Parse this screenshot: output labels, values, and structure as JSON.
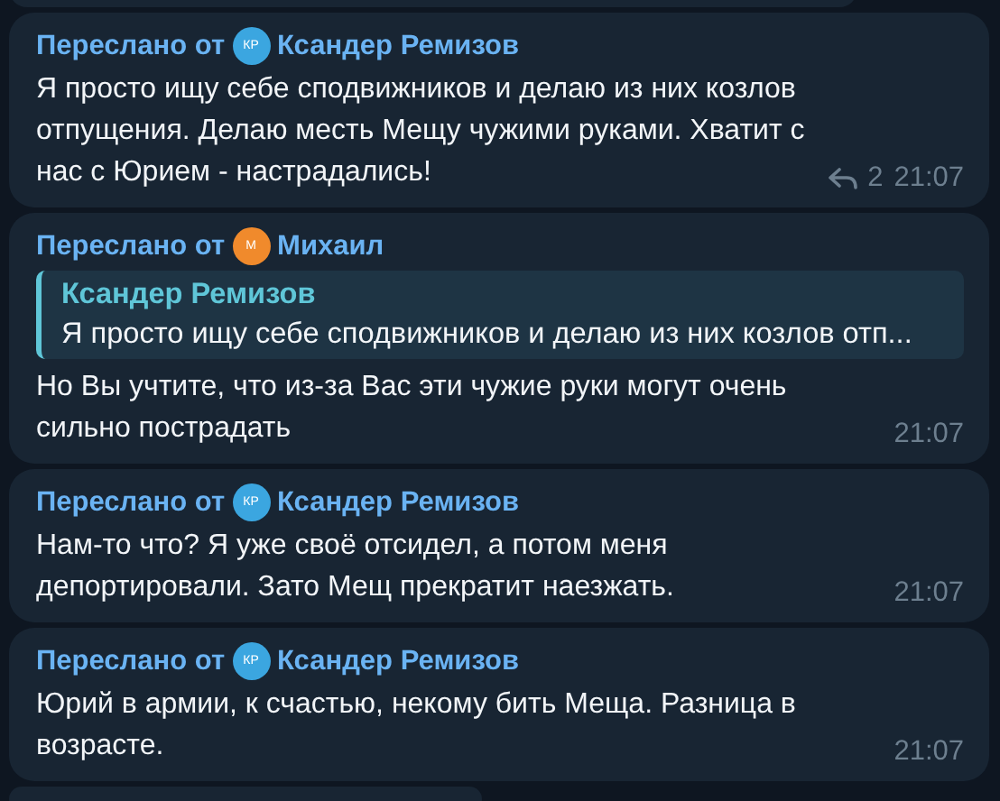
{
  "messages": [
    {
      "forwarded_label": "Переслано от",
      "from": {
        "initials": "КР",
        "name": "Ксандер Ремизов",
        "color": "#3ba6e0"
      },
      "text": "Я просто ищу себе сподвижников и делаю из них козлов отпущения. Делаю месть Мещу чужими руками. Хватит с нас с Юрием - настрадались!",
      "replies": "2",
      "time": "21:07"
    },
    {
      "forwarded_label": "Переслано от",
      "from": {
        "initials": "М",
        "name": "Михаил",
        "color": "#f08a2c"
      },
      "quote": {
        "name": "Ксандер Ремизов",
        "text": "Я просто ищу себе сподвижников и делаю из них козлов отп..."
      },
      "text": "Но Вы учтите, что из-за Вас эти чужие руки могут очень сильно пострадать",
      "time": "21:07"
    },
    {
      "forwarded_label": "Переслано от",
      "from": {
        "initials": "КР",
        "name": "Ксандер Ремизов",
        "color": "#3ba6e0"
      },
      "text": "Нам-то что? Я уже своё отсидел, а потом меня депортировали. Зато Мещ прекратит наезжать.",
      "time": "21:07"
    },
    {
      "forwarded_label": "Переслано от",
      "from": {
        "initials": "КР",
        "name": "Ксандер Ремизов",
        "color": "#3ba6e0"
      },
      "text": "Юрий в армии, к счастью, некому бить Меща. Разница в возрасте.",
      "time": "21:07"
    }
  ]
}
